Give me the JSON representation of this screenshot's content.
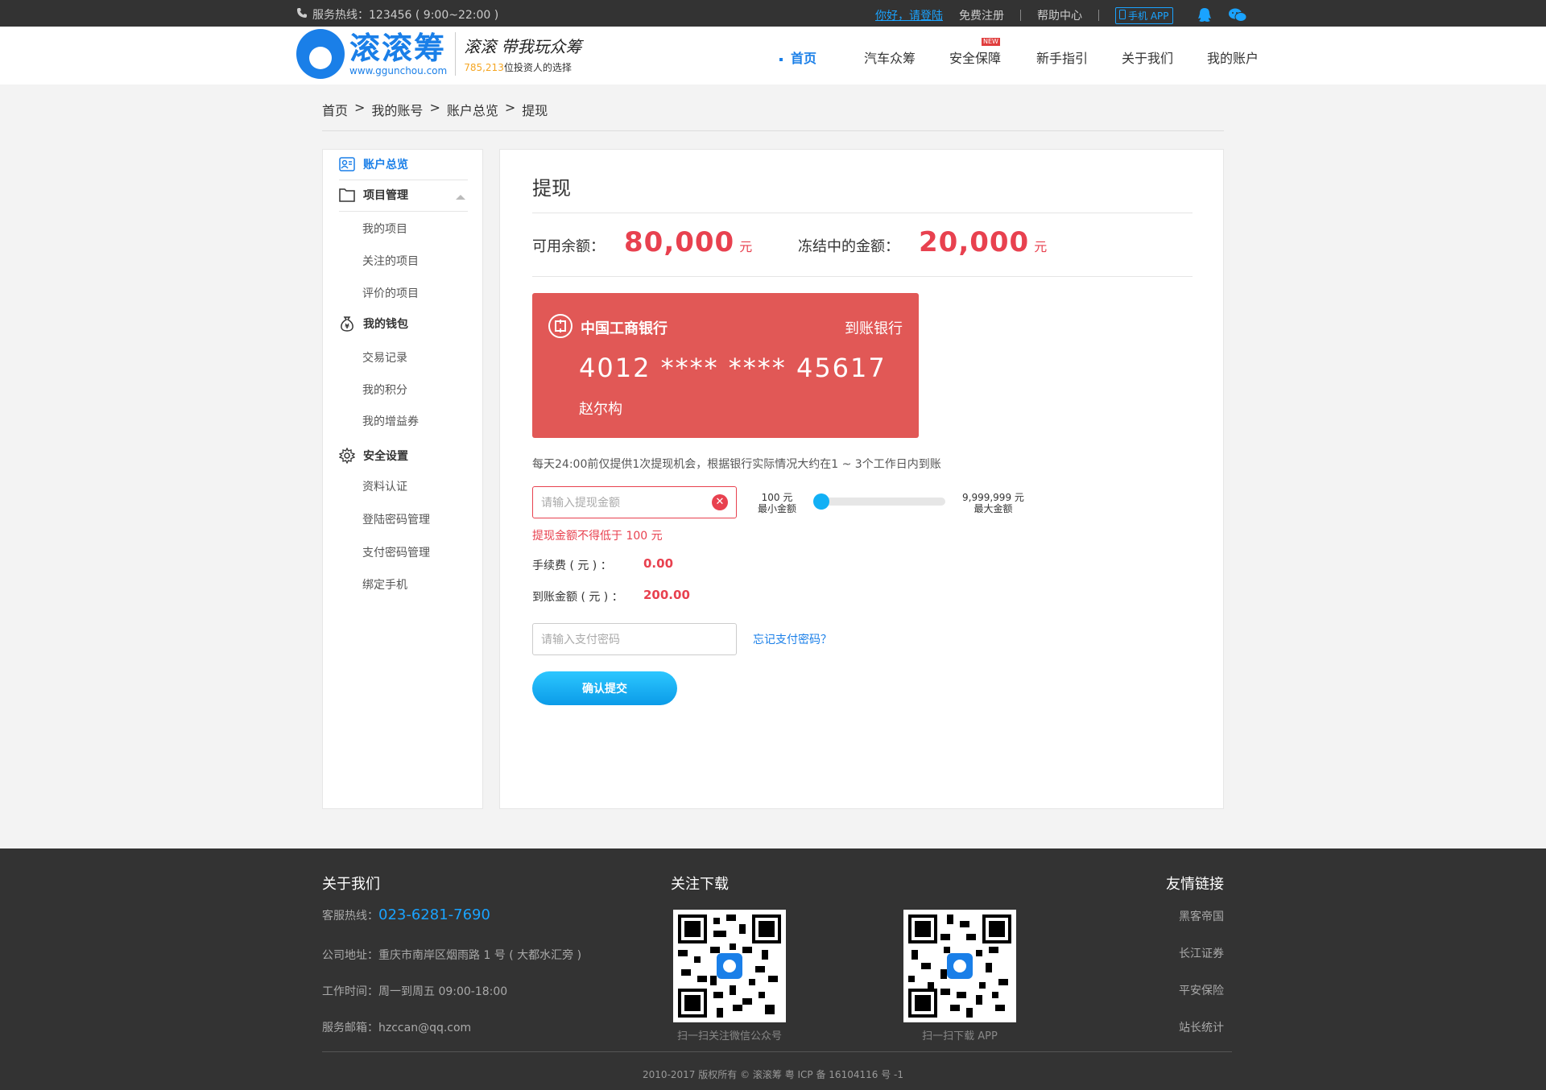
{
  "topbar": {
    "hotline": "服务热线：123456 ( 9:00~22:00 )",
    "login": "你好，请登陆",
    "register": "免费注册",
    "help": "帮助中心",
    "app": "手机 APP"
  },
  "logo": {
    "brand": "滚滚筹",
    "url": "www.ggunchou.com",
    "slogan": "滚滚 带我玩众筹",
    "investors": "785,213",
    "investors_suffix": "位投资人的选择"
  },
  "nav": {
    "items": [
      "首页",
      "汽车众筹",
      "安全保障",
      "新手指引",
      "关于我们",
      "我的账户"
    ],
    "new_badge": "NEW",
    "active_index": 0
  },
  "breadcrumb": [
    "首页",
    ">",
    "我的账号",
    ">",
    "账户总览",
    ">",
    "提现"
  ],
  "sidebar": {
    "overview": "账户总览",
    "project_mgmt": "项目管理",
    "project_items": [
      "我的项目",
      "关注的项目",
      "评价的项目"
    ],
    "wallet": "我的钱包",
    "wallet_items": [
      "交易记录",
      "我的积分",
      "我的增益券"
    ],
    "security": "安全设置",
    "security_items": [
      "资料认证",
      "登陆密码管理",
      "支付密码管理",
      "绑定手机"
    ]
  },
  "main": {
    "title": "提现",
    "available_label": "可用余额：",
    "available_amount": "80,000",
    "frozen_label": "冻结中的金额：",
    "frozen_amount": "20,000",
    "currency": "元",
    "card": {
      "bank": "中国工商银行",
      "arrive": "到账银行",
      "number": "4012 **** **** 45617",
      "holder": "赵尔构"
    },
    "note": "每天24:00前仅提供1次提现机会，根据银行实际情况大约在1 ~ 3个工作日内到账",
    "amount_placeholder": "请输入提现金额",
    "min_value": "100 元",
    "min_label": "最小金额",
    "max_value": "9,999,999 元",
    "max_label": "最大金额",
    "error": "提现金额不得低于 100 元",
    "fee_label": "手续费 ( 元 ) ：",
    "fee_value": "0.00",
    "arrive_label": "到账金额 ( 元 ) ：",
    "arrive_value": "200.00",
    "password_placeholder": "请输入支付密码",
    "forgot": "忘记支付密码？",
    "submit": "确认提交"
  },
  "footer": {
    "about_title": "关于我们",
    "hotline_label": "客服热线：",
    "hotline": "023-6281-7690",
    "address": "公司地址：重庆市南岸区烟雨路 1 号 ( 大都水汇旁 )",
    "hours": "工作时间：周一到周五  09:00-18:00",
    "email": "服务邮箱：hzccan@qq.com",
    "follow_title": "关注下载",
    "qr1_caption": "扫一扫关注微信公众号",
    "qr2_caption": "扫一扫下载 APP",
    "links_title": "友情链接",
    "links": [
      "黑客帝国",
      "长江证券",
      "平安保险",
      "站长统计"
    ],
    "copyright": "2010-2017 版权所有 © 滚滚筹 粤 ICP 备 16104116 号 -1"
  },
  "colors": {
    "brand_blue": "#1a7fe8",
    "accent_red": "#e8414f",
    "card_red": "#e15856",
    "slider_blue": "#12b0f5"
  }
}
